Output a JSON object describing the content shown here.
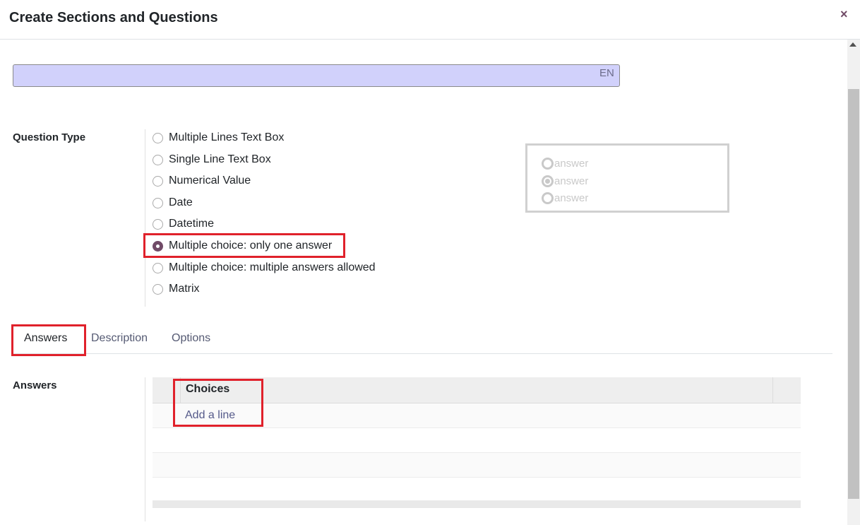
{
  "dialog": {
    "title": "Create Sections and Questions",
    "close_icon": "×"
  },
  "title_field": {
    "value": "",
    "lang": "EN"
  },
  "question_type": {
    "label": "Question Type",
    "options": [
      {
        "label": "Multiple Lines Text Box",
        "checked": false
      },
      {
        "label": "Single Line Text Box",
        "checked": false
      },
      {
        "label": "Numerical Value",
        "checked": false
      },
      {
        "label": "Date",
        "checked": false
      },
      {
        "label": "Datetime",
        "checked": false
      },
      {
        "label": "Multiple choice: only one answer",
        "checked": true
      },
      {
        "label": "Multiple choice: multiple answers allowed",
        "checked": false
      },
      {
        "label": "Matrix",
        "checked": false
      }
    ]
  },
  "preview": {
    "answers": [
      "answer",
      "answer",
      "answer"
    ],
    "selected_index": 1
  },
  "tabs": [
    {
      "label": "Answers",
      "active": true
    },
    {
      "label": "Description",
      "active": false
    },
    {
      "label": "Options",
      "active": false
    }
  ],
  "answers_section": {
    "label": "Answers",
    "column_header": "Choices",
    "add_line": "Add a line"
  },
  "colors": {
    "accent": "#714b67",
    "highlight": "#e0212b",
    "title_bg": "#d1d1fb"
  }
}
